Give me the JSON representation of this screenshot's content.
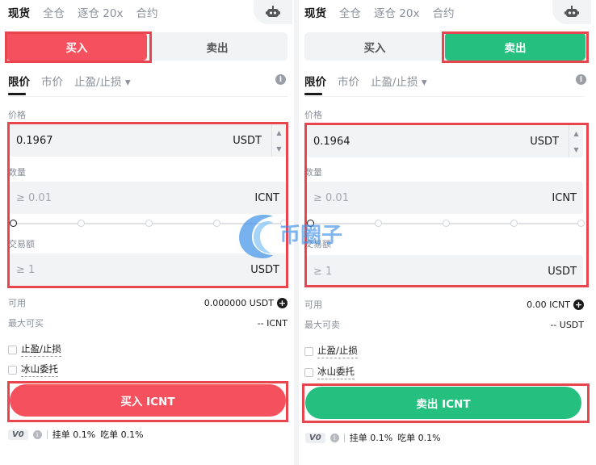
{
  "top_tabs": [
    "现货",
    "全仓",
    "逐仓 20x",
    "合约"
  ],
  "side_tabs": {
    "buy": "买入",
    "sell": "卖出"
  },
  "order_types": {
    "limit": "限价",
    "market": "市价",
    "stop": "止盈/止损 ▾"
  },
  "labels": {
    "price": "价格",
    "amount": "数量",
    "total": "交易额"
  },
  "buy_panel": {
    "price_value": "0.1967",
    "price_unit": "USDT",
    "amount_placeholder": "≥ 0.01",
    "amount_unit": "ICNT",
    "total_placeholder": "≥ 1",
    "total_unit": "USDT",
    "available_label": "可用",
    "available_value": "0.000000 USDT",
    "max_label": "最大可买",
    "max_value": "-- ICNT",
    "submit_label": "买入 ICNT"
  },
  "sell_panel": {
    "price_value": "0.1964",
    "price_unit": "USDT",
    "amount_placeholder": "≥ 0.01",
    "amount_unit": "ICNT",
    "total_placeholder": "≥ 1",
    "total_unit": "USDT",
    "available_label": "可用",
    "available_value": "0.00 ICNT",
    "max_label": "最大可卖",
    "max_value": "-- USDT",
    "submit_label": "卖出 ICNT"
  },
  "options": {
    "tp_sl": "止盈/止损",
    "iceberg": "冰山委托"
  },
  "fees": {
    "vip": "V0",
    "maker": "挂单 0.1%",
    "taker": "吃单 0.1%"
  },
  "watermark_text": "币圈子",
  "colors": {
    "buy": "#f5505e",
    "sell": "#25c07f",
    "highlight": "#e8454f"
  }
}
